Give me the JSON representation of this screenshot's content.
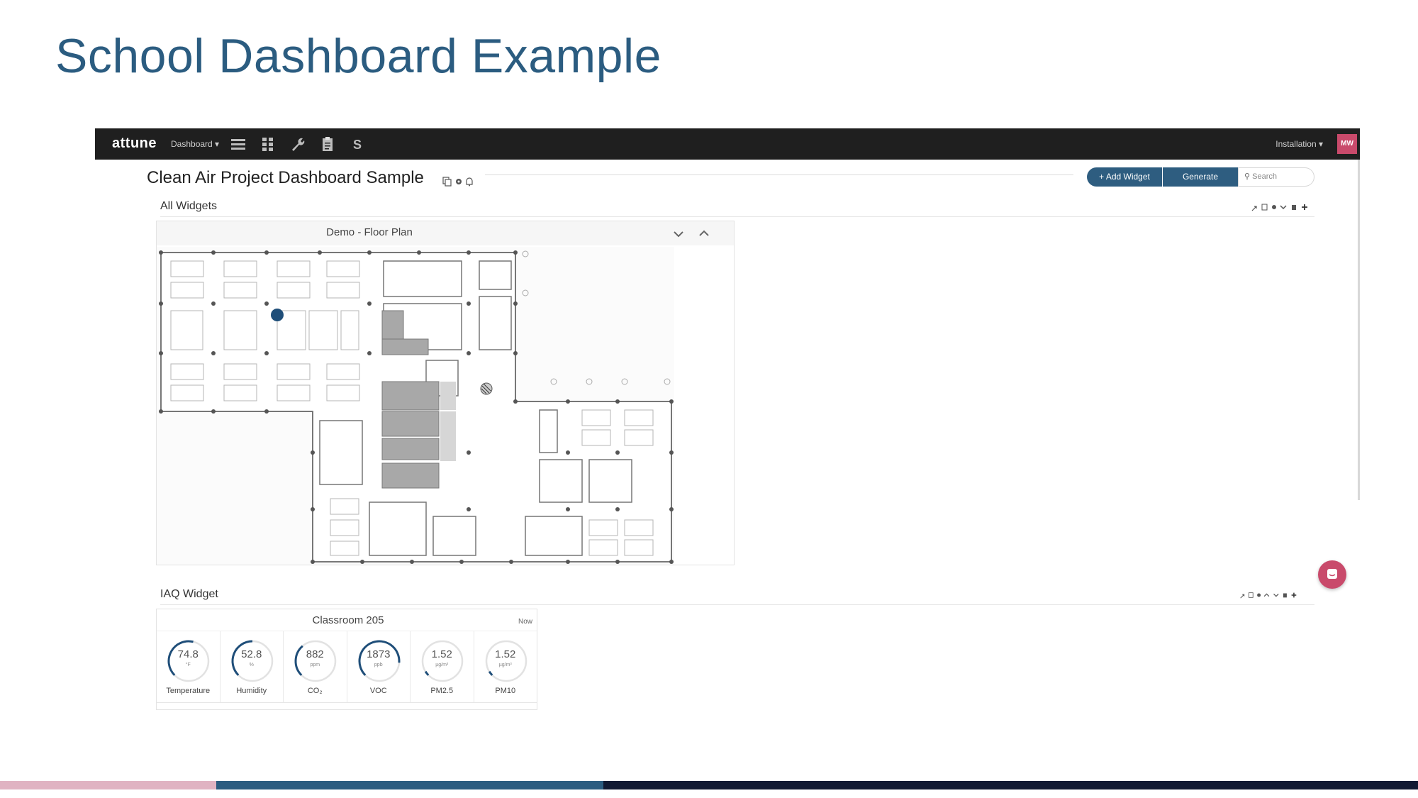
{
  "slide": {
    "title": "School Dashboard Example"
  },
  "topbar": {
    "logo": "attune",
    "dashboard_menu": "Dashboard ▾",
    "installation_menu": "Installation ▾",
    "avatar_initials": "MW",
    "nav_icons": [
      "list-icon",
      "grid-icon",
      "wrench-icon",
      "clipboard-icon",
      "s-icon"
    ]
  },
  "dashboard": {
    "title": "Clean Air Project Dashboard Sample",
    "add_widget_label": "+ Add Widget",
    "generate_label": "Generate",
    "search_placeholder": "Search"
  },
  "sections": {
    "all_widgets": "All Widgets",
    "iaq_widget": "IAQ Widget"
  },
  "floor_plan": {
    "title": "Demo - Floor Plan"
  },
  "iaq": {
    "room": "Classroom 205",
    "time": "Now",
    "metrics": [
      {
        "value": "74.8",
        "unit": "°F",
        "label": "Temperature",
        "fill": 0.55
      },
      {
        "value": "52.8",
        "unit": "%",
        "label": "Humidity",
        "fill": 0.5
      },
      {
        "value": "882",
        "unit": "ppm",
        "label": "CO₂",
        "fill": 0.35
      },
      {
        "value": "1873",
        "unit": "ppb",
        "label": "VOC",
        "fill": 0.85
      },
      {
        "value": "1.52",
        "unit": "µg/m³",
        "label": "PM2.5",
        "fill": 0.05
      },
      {
        "value": "1.52",
        "unit": "µg/m³",
        "label": "PM10",
        "fill": 0.05
      }
    ]
  },
  "colors": {
    "title_blue": "#2b5c80",
    "button_blue": "#2e5d80",
    "topbar": "#1f1f1f",
    "accent_pink": "#c94a6b",
    "bottom_bar_pink": "#e0b3c2",
    "bottom_bar_blue": "#2b5c80",
    "bottom_bar_navy": "#111a33"
  }
}
